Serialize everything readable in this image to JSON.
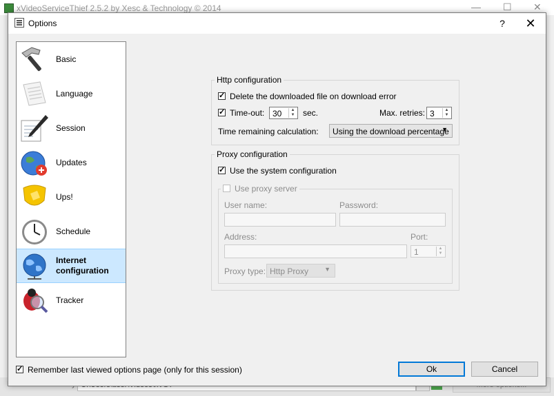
{
  "background_window": {
    "title": "xVideoServiceThief 2.5.2 by Xesc & Technology © 2014",
    "download_label": "Downloads directory:",
    "download_path": "C:\\Users\\user\\Videos\\xVST",
    "browse_label": "...",
    "more_options_label": "More options..."
  },
  "dialog": {
    "title": "Options",
    "help_label": "?",
    "close_label": "✕"
  },
  "sidebar": {
    "items": [
      {
        "label": "Basic",
        "icon": "hammer-icon"
      },
      {
        "label": "Language",
        "icon": "scroll-icon"
      },
      {
        "label": "Session",
        "icon": "pen-paper-icon"
      },
      {
        "label": "Updates",
        "icon": "globe-update-icon"
      },
      {
        "label": "Ups!",
        "icon": "warning-shield-icon"
      },
      {
        "label": "Schedule",
        "icon": "clock-icon"
      },
      {
        "label": "Internet\nconfiguration",
        "line1": "Internet",
        "line2": "configuration",
        "icon": "internet-globe-icon",
        "selected": true
      },
      {
        "label": "Tracker",
        "icon": "bug-magnifier-icon"
      }
    ]
  },
  "http": {
    "group_title": "Http configuration",
    "delete_label": "Delete the downloaded file on download error",
    "delete_checked": true,
    "timeout_label": "Time-out:",
    "timeout_checked": true,
    "timeout_value": "30",
    "timeout_unit": "sec.",
    "retries_label": "Max. retries:",
    "retries_value": "3",
    "remaining_label": "Time remaining calculation:",
    "remaining_value": "Using the download percentage"
  },
  "proxy": {
    "group_title": "Proxy configuration",
    "system_label": "Use the system configuration",
    "system_checked": true,
    "use_proxy_label": "Use proxy server",
    "use_proxy_checked": false,
    "username_label": "User name:",
    "password_label": "Password:",
    "address_label": "Address:",
    "port_label": "Port:",
    "port_value": "1",
    "type_label": "Proxy type:",
    "type_value": "Http Proxy"
  },
  "footer": {
    "remember_label": "Remember last viewed options page (only for this session)",
    "remember_checked": true,
    "ok_label": "Ok",
    "cancel_label": "Cancel"
  },
  "colors": {
    "accent": "#0078d7",
    "selection": "#cce8ff"
  }
}
